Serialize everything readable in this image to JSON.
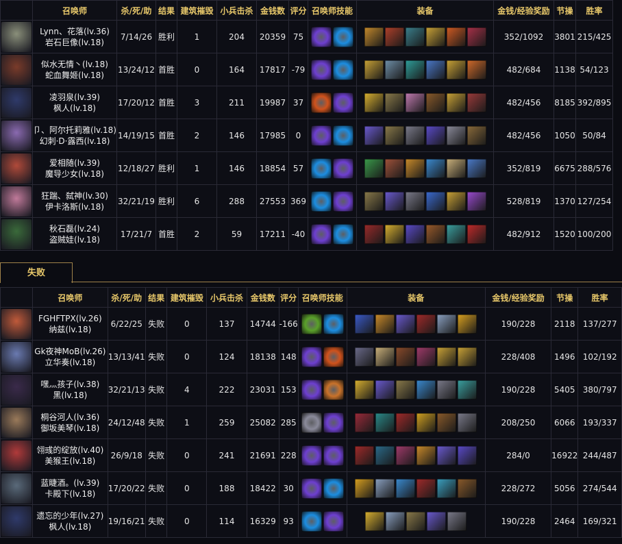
{
  "headers": {
    "summoner": "召唤师",
    "kda": "杀/死/助",
    "result": "结果",
    "towers": "建筑摧毁",
    "cs": "小兵击杀",
    "gold": "金钱数",
    "score": "评分",
    "spells": "召唤师技能",
    "items": "装备",
    "reward": "金钱/经验奖励",
    "honor": "节操",
    "winrate": "胜率"
  },
  "lose_tab": "失败",
  "win_team": [
    {
      "name": "Lynn、花落(lv.36)",
      "hero": "岩石巨像(lv.18)",
      "kda": "7/14/26",
      "result": "胜利",
      "towers": "1",
      "cs": "204",
      "gold": "20359",
      "score": "75",
      "reward": "352/1092",
      "honor": "3801",
      "winrate": "215/425",
      "avatar": "#8a8f7a",
      "spells": [
        "#6d3fd0",
        "#1c8de0"
      ],
      "items": [
        "#c48a2c",
        "#b0402a",
        "#3a7f8c",
        "#c9a236",
        "#d05a22",
        "#a83048"
      ]
    },
    {
      "name": "似水无情丶(lv.18)",
      "hero": "蛇血舞姬(lv.18)",
      "kda": "13/24/12",
      "result": "首胜",
      "towers": "0",
      "cs": "164",
      "gold": "17817",
      "score": "-79",
      "reward": "482/684",
      "honor": "1138",
      "winrate": "54/123",
      "avatar": "#7a3b2a",
      "spells": [
        "#6d3fd0",
        "#1c8de0"
      ],
      "items": [
        "#c9a236",
        "#6f8fa8",
        "#2f9e9a",
        "#4a78c9",
        "#c9a236",
        "#d06a2a"
      ]
    },
    {
      "name": "凌羽泉(lv.39)",
      "hero": "枫人(lv.18)",
      "kda": "17/20/12",
      "result": "首胜",
      "towers": "3",
      "cs": "211",
      "gold": "19987",
      "score": "37",
      "reward": "482/456",
      "honor": "8185",
      "winrate": "392/895",
      "avatar": "#2f3a6a",
      "spells": [
        "#d0521c",
        "#6d3fd0"
      ],
      "items": [
        "#d8b030",
        "#8a7a4a",
        "#c07ab0",
        "#8a5a2a",
        "#c9a236",
        "#9a3a3a"
      ]
    },
    {
      "name": "卩、阿尔托莉雅(lv.18)",
      "hero": "幻刺·D·露西(lv.18)",
      "kda": "14/19/15",
      "result": "首胜",
      "towers": "2",
      "cs": "146",
      "gold": "17985",
      "score": "0",
      "reward": "482/456",
      "honor": "1050",
      "winrate": "50/84",
      "avatar": "#8a6ab0",
      "spells": [
        "#6d3fd0",
        "#1c8de0"
      ],
      "items": [
        "#6a5ad0",
        "#8a7a4a",
        "#7a7a8a",
        "#5a4ac9",
        "#8a8a9a",
        "#8a6a3a"
      ]
    },
    {
      "name": "爱相随(lv.39)",
      "hero": "魔导少女(lv.18)",
      "kda": "12/18/27",
      "result": "胜利",
      "towers": "1",
      "cs": "146",
      "gold": "18854",
      "score": "57",
      "reward": "352/819",
      "honor": "6675",
      "winrate": "288/576",
      "avatar": "#b04a3a",
      "spells": [
        "#1c8de0",
        "#6d3fd0"
      ],
      "items": [
        "#3a9a4a",
        "#a0523a",
        "#c98a2a",
        "#3a8ad0",
        "#c9b07a",
        "#4a7ac9"
      ]
    },
    {
      "name": "狂踹、弑神(lv.30)",
      "hero": "伊卡洛斯(lv.18)",
      "kda": "32/21/19",
      "result": "胜利",
      "towers": "6",
      "cs": "288",
      "gold": "27553",
      "score": "369",
      "reward": "528/819",
      "honor": "1370",
      "winrate": "127/254",
      "avatar": "#c07a9a",
      "spells": [
        "#1c8de0",
        "#6d3fd0"
      ],
      "items": [
        "#8a7a4a",
        "#6a5ad0",
        "#7a7a8a",
        "#3a6ad0",
        "#c9a236",
        "#9a4ad0"
      ]
    },
    {
      "name": "秋石磊(lv.24)",
      "hero": "盗贼娃(lv.18)",
      "kda": "17/21/7",
      "result": "首胜",
      "towers": "2",
      "cs": "59",
      "gold": "17211",
      "score": "-40",
      "reward": "482/912",
      "honor": "1520",
      "winrate": "100/200",
      "avatar": "#3a6a3a",
      "spells": [
        "#6d3fd0",
        "#1c8de0"
      ],
      "items": [
        "#9a2a2a",
        "#d8b030",
        "#5a4ac9",
        "#9a5a2a",
        "#3aa0a0",
        "#c02a2a"
      ]
    }
  ],
  "lose_team": [
    {
      "name": "FGHFTPX(lv.26)",
      "hero": "纳兹(lv.18)",
      "kda": "6/22/25",
      "result": "失败",
      "towers": "0",
      "cs": "137",
      "gold": "14744",
      "score": "-166",
      "reward": "190/228",
      "honor": "2118",
      "winrate": "137/277",
      "avatar": "#c05a3a",
      "spells": [
        "#5aa02a",
        "#1c8de0"
      ],
      "items": [
        "#3a5ac9",
        "#c98a2a",
        "#6a5ad0",
        "#a02a2a",
        "#8aa0c0",
        "#d8a020"
      ]
    },
    {
      "name": "Gk夜神MoB(lv.26)",
      "hero": "立华奏(lv.18)",
      "kda": "13/13/41",
      "result": "失败",
      "towers": "0",
      "cs": "124",
      "gold": "18138",
      "score": "148",
      "reward": "228/408",
      "honor": "1496",
      "winrate": "102/192",
      "avatar": "#6a7ab0",
      "spells": [
        "#6d3fd0",
        "#d0521c"
      ],
      "items": [
        "#6a6a8a",
        "#c9b07a",
        "#8a4a2a",
        "#a03a6a",
        "#c9a236",
        "#c9a236"
      ]
    },
    {
      "name": "嘿灬孩子(lv.38)",
      "hero": "黑(lv.18)",
      "kda": "32/21/13",
      "result": "失败",
      "towers": "4",
      "cs": "222",
      "gold": "23031",
      "score": "153",
      "reward": "190/228",
      "honor": "5405",
      "winrate": "380/797",
      "avatar": "#3a2a4a",
      "spells": [
        "#6d3fd0",
        "#c9722a"
      ],
      "items": [
        "#d8b030",
        "#6a5ad0",
        "#8a7a4a",
        "#3a8ad0",
        "#7a7a8a",
        "#3aa0a0"
      ]
    },
    {
      "name": "桐谷河人(lv.36)",
      "hero": "御坂美琴(lv.18)",
      "kda": "24/12/48",
      "result": "失败",
      "towers": "1",
      "cs": "259",
      "gold": "25082",
      "score": "285",
      "reward": "208/250",
      "honor": "6066",
      "winrate": "193/337",
      "avatar": "#9a7a5a",
      "spells": [
        "#8a8a9a",
        "#6d3fd0"
      ],
      "items": [
        "#9a2a3a",
        "#2a8a8a",
        "#a02a2a",
        "#d0a020",
        "#8a5a2a",
        "#7a7a8a"
      ]
    },
    {
      "name": "翎彧的绽放(lv.40)",
      "hero": "美猴王(lv.18)",
      "kda": "26/9/18",
      "result": "失败",
      "towers": "0",
      "cs": "241",
      "gold": "21691",
      "score": "228",
      "reward": "284/0",
      "honor": "16922",
      "winrate": "244/487",
      "avatar": "#b03a3a",
      "spells": [
        "#6d3fd0",
        "#6d3fd0"
      ],
      "items": [
        "#a02a2a",
        "#2a6a8a",
        "#a03a6a",
        "#c98a2a",
        "#6a5ad0",
        "#5a4ac9"
      ]
    },
    {
      "name": "蓝睫酒。(lv.39)",
      "hero": "卡殿下(lv.18)",
      "kda": "17/20/22",
      "result": "失败",
      "towers": "0",
      "cs": "188",
      "gold": "18422",
      "score": "30",
      "reward": "228/272",
      "honor": "5056",
      "winrate": "274/544",
      "avatar": "#5a6a7a",
      "spells": [
        "#6d3fd0",
        "#1c8de0"
      ],
      "items": [
        "#d8a020",
        "#8aa0c0",
        "#3a8ad0",
        "#a02a2a",
        "#3aa0c0",
        "#8a5a2a"
      ]
    },
    {
      "name": "遗忘的少年(lv.27)",
      "hero": "枫人(lv.18)",
      "kda": "19/16/21",
      "result": "失败",
      "towers": "0",
      "cs": "114",
      "gold": "16329",
      "score": "93",
      "reward": "190/228",
      "honor": "2464",
      "winrate": "169/321",
      "avatar": "#2f3a6a",
      "spells": [
        "#1c8de0",
        "#6d3fd0"
      ],
      "items": [
        "#d8b030",
        "#8aa0c0",
        "#8a7a4a",
        "#6a5ad0",
        "#7a7a8a"
      ]
    }
  ]
}
